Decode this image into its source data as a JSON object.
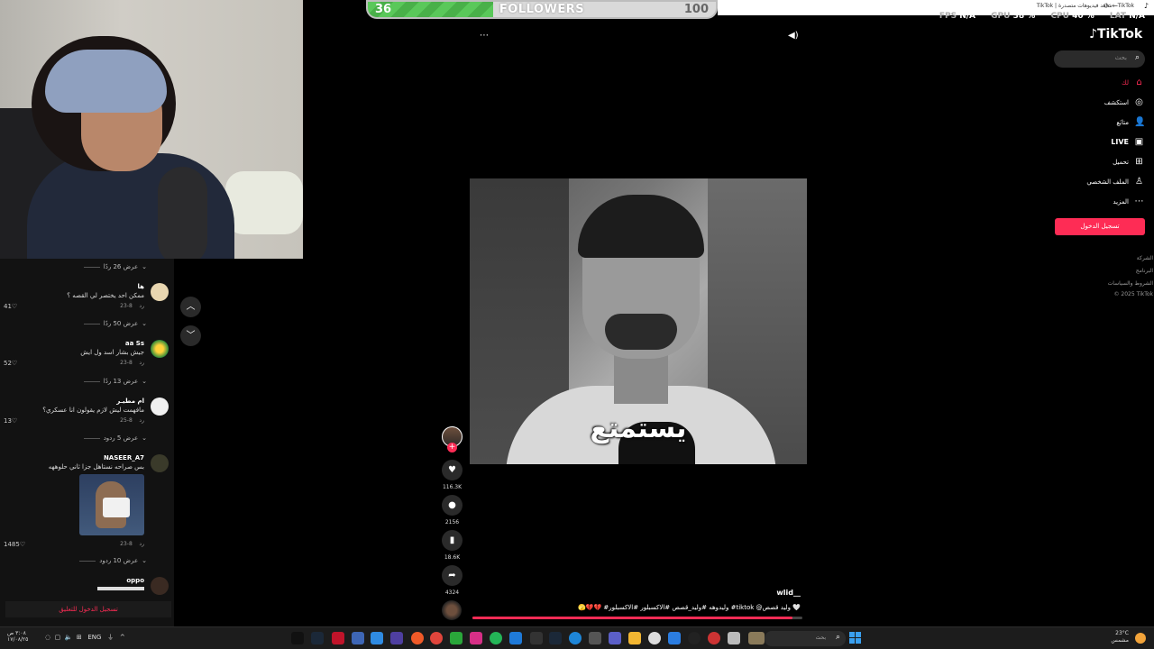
{
  "followers_bar": {
    "current": "36",
    "label": "FOLLOWERS",
    "goal": "100",
    "progress": 0.36
  },
  "window_title": "TikTok | شاهد فيديوهات متصدرة - TikTok",
  "stats": {
    "fps_label": "FPS",
    "fps_value": "N/A",
    "gpu_label": "GPU",
    "gpu_value": "38 %",
    "cpu_label": "CPU",
    "cpu_value": "40 %",
    "lat_label": "LAT",
    "lat_value": "N/A"
  },
  "sidebar": {
    "logo": "TikTok",
    "search_placeholder": "بحث",
    "items": [
      {
        "label": "لك",
        "icon": "home-icon",
        "active": true
      },
      {
        "label": "استكشف",
        "icon": "compass-icon",
        "active": false
      },
      {
        "label": "متابَع",
        "icon": "following-icon",
        "active": false
      },
      {
        "label": "LIVE",
        "icon": "live-icon",
        "active": false
      },
      {
        "label": "تحميل",
        "icon": "upload-icon",
        "active": false
      },
      {
        "label": "الملف الشخصي",
        "icon": "profile-icon",
        "active": false
      },
      {
        "label": "المزيد",
        "icon": "more-icon",
        "active": false
      }
    ],
    "login_button": "تسجيل الدخول",
    "footer": [
      "الشركة",
      "البرنامج",
      "الشروط والسياسات",
      "© 2025 TikTok"
    ]
  },
  "comments": {
    "view_more_1": "عرض 26 ردًا",
    "c1": {
      "user": "ها",
      "text": "ممكن احد يختصر لي القصه ؟",
      "date": "8-23",
      "reply": "رد",
      "likes": "41"
    },
    "view_more_2": "عرض 50 ردًا",
    "c2": {
      "user": "aa Ss",
      "text": "جيش بشار اسد ول ايش",
      "date": "8-23",
      "reply": "رد",
      "likes": "52"
    },
    "view_more_3": "عرض 13 ردًا",
    "c3": {
      "user": "ام مطيـر",
      "text": "مافهمت ليش لازم يقولون انا عسكري؟",
      "date": "8-25",
      "reply": "رد",
      "likes": "13"
    },
    "view_more_4": "عرض 5 ردود",
    "c4": {
      "user": "NASEER_A7",
      "text": "بس صراحه نستاهل جزا ثاني حلوههه",
      "date": "8-23",
      "reply": "رد",
      "likes": "1485"
    },
    "view_more_5": "عرض 10 ردود",
    "c5": {
      "user": "oppo"
    },
    "login_prompt": "تسجيل الدخول للتعليق"
  },
  "video": {
    "subtitle": "يستمتع",
    "author": "wlid__",
    "caption": "🫣💔💔 #وليدوهه #وليد_قصص #الاكسبلور #الاكسبلور #tiktok @وليد قصص 🤍",
    "progress": 0.97,
    "likes": "116.3K",
    "comments": "2156",
    "saves": "18.6K",
    "shares": "4324"
  },
  "taskbar": {
    "search_placeholder": "بحث",
    "clock_time": "٣:٠٨ ص",
    "clock_date": "١٧/٠٨/٢٥",
    "lang": "ENG",
    "weather_temp": "23°C",
    "weather_desc": "مشمس"
  }
}
